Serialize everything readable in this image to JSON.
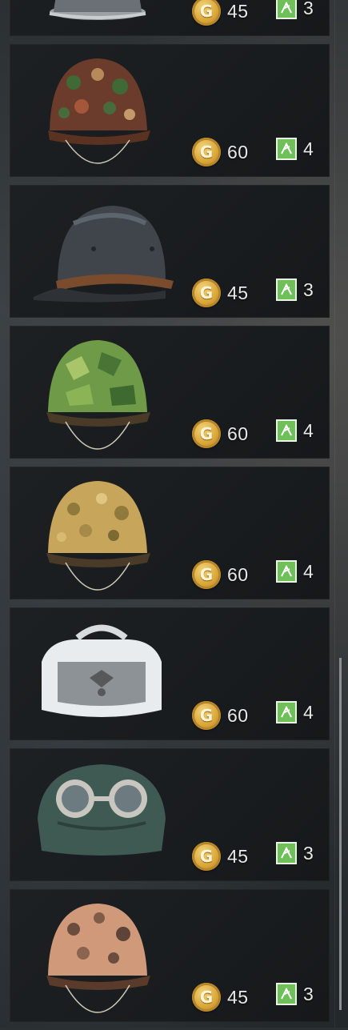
{
  "items": [
    {
      "gold": "45",
      "tokens": "3",
      "helmet": "steel-gray"
    },
    {
      "gold": "60",
      "tokens": "4",
      "helmet": "camo-pea-dot"
    },
    {
      "gold": "45",
      "tokens": "3",
      "helmet": "steel-dark"
    },
    {
      "gold": "60",
      "tokens": "4",
      "helmet": "camo-oak-green"
    },
    {
      "gold": "60",
      "tokens": "4",
      "helmet": "camo-tan-dot"
    },
    {
      "gold": "60",
      "tokens": "4",
      "helmet": "winter-fur-cap"
    },
    {
      "gold": "45",
      "tokens": "3",
      "helmet": "goggles-helmet"
    },
    {
      "gold": "45",
      "tokens": "3",
      "helmet": "camo-pink-dot"
    }
  ],
  "icons": {
    "currency": "gold-coin-icon",
    "token": "green-token-icon"
  },
  "colors": {
    "gold": "#d9a63a",
    "token": "#6fbf5a",
    "card_bg": "#1b1e20"
  },
  "coin_glyph": "G"
}
